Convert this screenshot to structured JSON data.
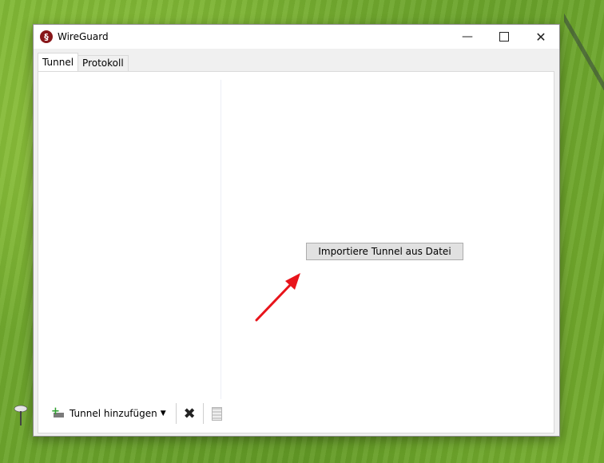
{
  "window": {
    "title": "WireGuard"
  },
  "tabs": [
    {
      "label": "Tunnel",
      "active": true
    },
    {
      "label": "Protokoll",
      "active": false
    }
  ],
  "main": {
    "import_button_label": "Importiere Tunnel aus Datei"
  },
  "toolbar": {
    "add_tunnel_label": "Tunnel hinzufügen"
  },
  "colors": {
    "annotation_arrow": "#e8141b",
    "app_icon": "#88171a",
    "add_icon": "#2fa12f"
  }
}
